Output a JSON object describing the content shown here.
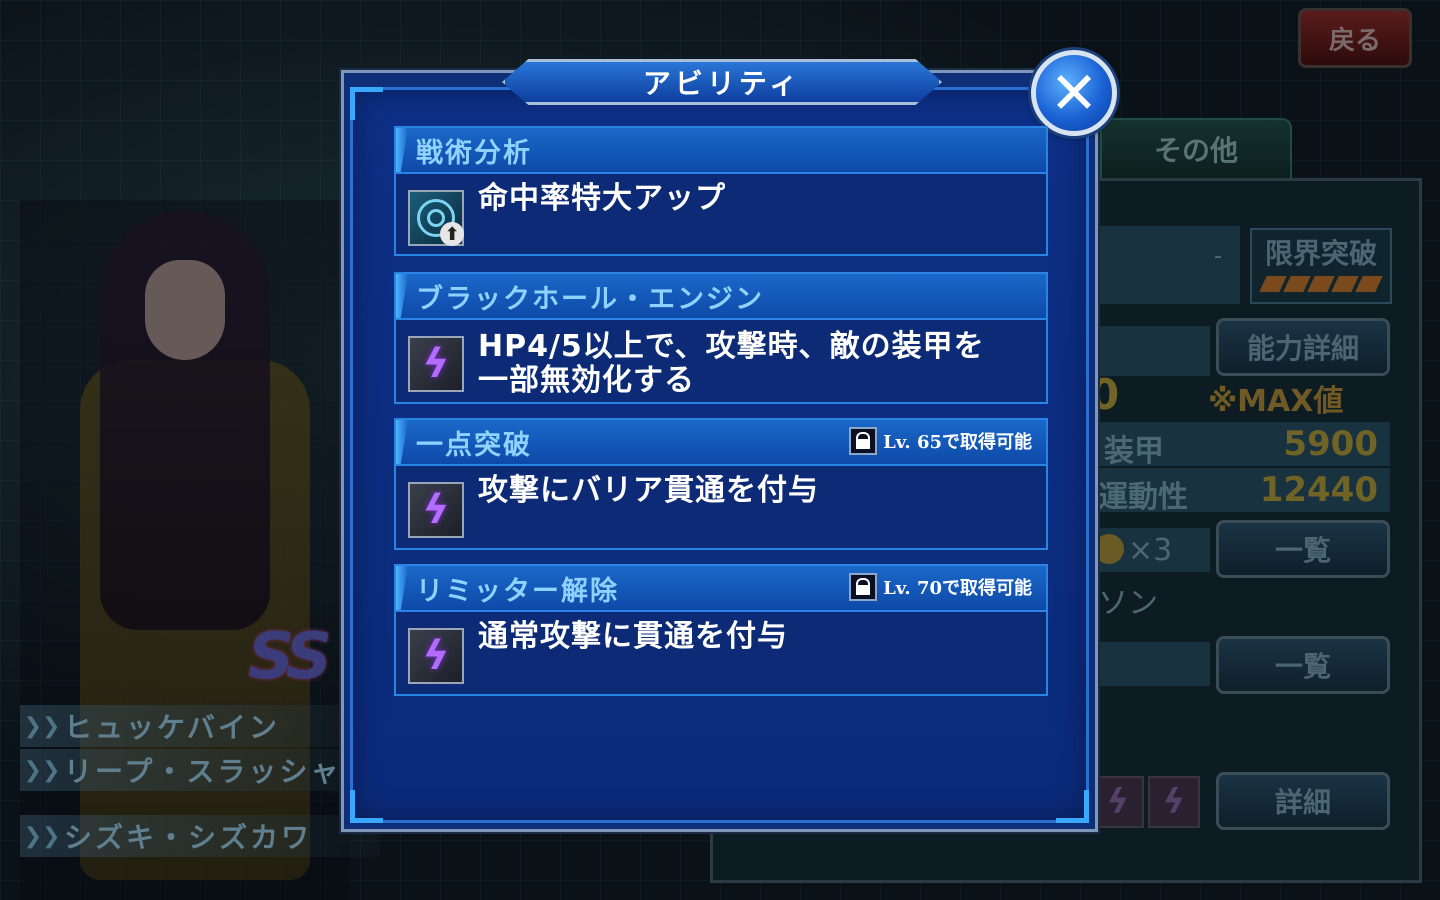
{
  "header": {
    "back_label": "戻る"
  },
  "modal": {
    "title": "アビリティ",
    "close_symbol": "✕",
    "abilities": [
      {
        "name": "戦術分析",
        "desc": "命中率特大アップ",
        "icon": "accuracy-up-icon",
        "lock": ""
      },
      {
        "name": "ブラックホール・エンジン",
        "desc": "HP4/5以上で、攻撃時、敵の装甲を\n一部無効化する",
        "icon": "bolt-icon",
        "lock": ""
      },
      {
        "name": "一点突破",
        "desc": "攻撃にバリア貫通を付与",
        "icon": "bolt-icon",
        "lock": "Lv. 65で取得可能"
      },
      {
        "name": "リミッター解除",
        "desc": "通常攻撃に貫通を付与",
        "icon": "bolt-icon",
        "lock": "Lv. 70で取得可能"
      }
    ]
  },
  "background": {
    "tab_other": "その他",
    "limit_break": "限界突破",
    "dash": "-",
    "detail_button": "能力詳細",
    "max_note": "※MAX値",
    "partial_value": "0",
    "stats": [
      {
        "label": "装甲",
        "value": "5900"
      },
      {
        "label": "運動性",
        "value": "12440"
      }
    ],
    "multiplier": "×3",
    "list_button_1": "一覧",
    "partial_text": "ソン",
    "list_button_2": "一覧",
    "details_button": "詳細",
    "pilots": [
      "ヒュッケバイン",
      "リープ・スラッシャー",
      "シズキ・シズカワ"
    ]
  },
  "colors": {
    "modal_bg": "#0e2f78",
    "ability_header": "#1a68c9",
    "ability_name": "#8fd2ff",
    "close_button": "#1a62d4"
  }
}
